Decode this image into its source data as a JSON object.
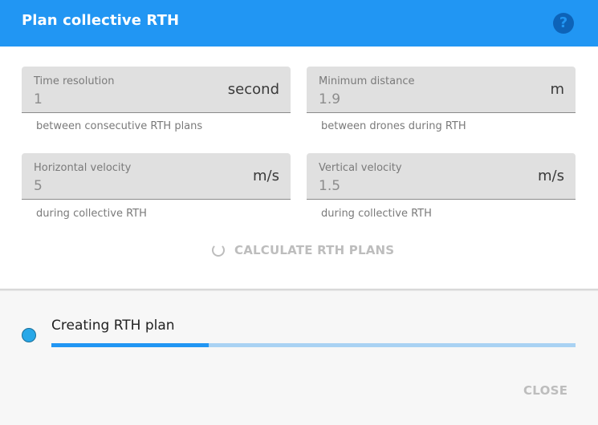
{
  "dialog": {
    "title": "Plan collective RTH",
    "help_glyph": "?"
  },
  "fields": [
    {
      "label": "Time resolution",
      "value": "1",
      "unit": "second",
      "helper": "between consecutive RTH plans"
    },
    {
      "label": "Minimum distance",
      "value": "1.9",
      "unit": "m",
      "helper": "between drones during RTH"
    },
    {
      "label": "Horizontal velocity",
      "value": "5",
      "unit": "m/s",
      "helper": "during collective RTH"
    },
    {
      "label": "Vertical velocity",
      "value": "1.5",
      "unit": "m/s",
      "helper": "during collective RTH"
    }
  ],
  "actions": {
    "calculate_label": "CALCULATE RTH PLANS",
    "close_label": "CLOSE"
  },
  "progress": {
    "status": "Creating RTH plan",
    "fraction": 0.3
  },
  "colors": {
    "accent": "#2196f3",
    "status_dot": "#29a8e8"
  },
  "icons": {
    "help": "help-icon",
    "spinner": "spinner-icon",
    "status": "status-dot-icon"
  }
}
